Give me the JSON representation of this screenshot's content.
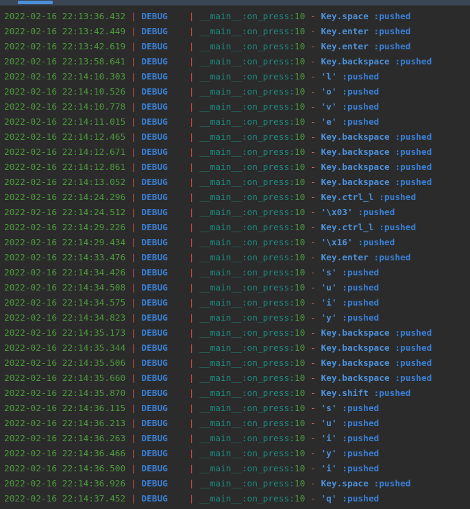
{
  "window": {
    "kind": "terminal-log-output",
    "background_color": "#2b2b2b",
    "topbar_color": "#3c4554",
    "scrollbar_color": "#4a90d9"
  },
  "colors": {
    "timestamp": "#4e9a3d",
    "separator": "#cc4c43",
    "level": "#3a7fd5",
    "module": "#1f8a82",
    "lineno": "#4e9a3d",
    "dash": "#d8705f",
    "message": "#3a7fd5"
  },
  "log": {
    "separator": "|",
    "dash": "-",
    "suffix": ":pushed",
    "lines": [
      {
        "timestamp": "2022-02-16 22:13:36.432",
        "level": "DEBUG",
        "module": "__main__",
        "func": "on_press",
        "lineno": "10",
        "key": "Key.space",
        "status": ":pushed"
      },
      {
        "timestamp": "2022-02-16 22:13:42.449",
        "level": "DEBUG",
        "module": "__main__",
        "func": "on_press",
        "lineno": "10",
        "key": "Key.enter",
        "status": ":pushed"
      },
      {
        "timestamp": "2022-02-16 22:13:42.619",
        "level": "DEBUG",
        "module": "__main__",
        "func": "on_press",
        "lineno": "10",
        "key": "Key.enter",
        "status": ":pushed"
      },
      {
        "timestamp": "2022-02-16 22:13:58.641",
        "level": "DEBUG",
        "module": "__main__",
        "func": "on_press",
        "lineno": "10",
        "key": "Key.backspace",
        "status": ":pushed"
      },
      {
        "timestamp": "2022-02-16 22:14:10.303",
        "level": "DEBUG",
        "module": "__main__",
        "func": "on_press",
        "lineno": "10",
        "key": "'l'",
        "status": ":pushed"
      },
      {
        "timestamp": "2022-02-16 22:14:10.526",
        "level": "DEBUG",
        "module": "__main__",
        "func": "on_press",
        "lineno": "10",
        "key": "'o'",
        "status": ":pushed"
      },
      {
        "timestamp": "2022-02-16 22:14:10.778",
        "level": "DEBUG",
        "module": "__main__",
        "func": "on_press",
        "lineno": "10",
        "key": "'v'",
        "status": ":pushed"
      },
      {
        "timestamp": "2022-02-16 22:14:11.015",
        "level": "DEBUG",
        "module": "__main__",
        "func": "on_press",
        "lineno": "10",
        "key": "'e'",
        "status": ":pushed"
      },
      {
        "timestamp": "2022-02-16 22:14:12.465",
        "level": "DEBUG",
        "module": "__main__",
        "func": "on_press",
        "lineno": "10",
        "key": "Key.backspace",
        "status": ":pushed"
      },
      {
        "timestamp": "2022-02-16 22:14:12.671",
        "level": "DEBUG",
        "module": "__main__",
        "func": "on_press",
        "lineno": "10",
        "key": "Key.backspace",
        "status": ":pushed"
      },
      {
        "timestamp": "2022-02-16 22:14:12.861",
        "level": "DEBUG",
        "module": "__main__",
        "func": "on_press",
        "lineno": "10",
        "key": "Key.backspace",
        "status": ":pushed"
      },
      {
        "timestamp": "2022-02-16 22:14:13.052",
        "level": "DEBUG",
        "module": "__main__",
        "func": "on_press",
        "lineno": "10",
        "key": "Key.backspace",
        "status": ":pushed"
      },
      {
        "timestamp": "2022-02-16 22:14:24.296",
        "level": "DEBUG",
        "module": "__main__",
        "func": "on_press",
        "lineno": "10",
        "key": "Key.ctrl_l",
        "status": ":pushed"
      },
      {
        "timestamp": "2022-02-16 22:14:24.512",
        "level": "DEBUG",
        "module": "__main__",
        "func": "on_press",
        "lineno": "10",
        "key": "'\\x03'",
        "status": ":pushed"
      },
      {
        "timestamp": "2022-02-16 22:14:29.226",
        "level": "DEBUG",
        "module": "__main__",
        "func": "on_press",
        "lineno": "10",
        "key": "Key.ctrl_l",
        "status": ":pushed"
      },
      {
        "timestamp": "2022-02-16 22:14:29.434",
        "level": "DEBUG",
        "module": "__main__",
        "func": "on_press",
        "lineno": "10",
        "key": "'\\x16'",
        "status": ":pushed"
      },
      {
        "timestamp": "2022-02-16 22:14:33.476",
        "level": "DEBUG",
        "module": "__main__",
        "func": "on_press",
        "lineno": "10",
        "key": "Key.enter",
        "status": ":pushed"
      },
      {
        "timestamp": "2022-02-16 22:14:34.426",
        "level": "DEBUG",
        "module": "__main__",
        "func": "on_press",
        "lineno": "10",
        "key": "'s'",
        "status": ":pushed"
      },
      {
        "timestamp": "2022-02-16 22:14:34.508",
        "level": "DEBUG",
        "module": "__main__",
        "func": "on_press",
        "lineno": "10",
        "key": "'u'",
        "status": ":pushed"
      },
      {
        "timestamp": "2022-02-16 22:14:34.575",
        "level": "DEBUG",
        "module": "__main__",
        "func": "on_press",
        "lineno": "10",
        "key": "'i'",
        "status": ":pushed"
      },
      {
        "timestamp": "2022-02-16 22:14:34.823",
        "level": "DEBUG",
        "module": "__main__",
        "func": "on_press",
        "lineno": "10",
        "key": "'y'",
        "status": ":pushed"
      },
      {
        "timestamp": "2022-02-16 22:14:35.173",
        "level": "DEBUG",
        "module": "__main__",
        "func": "on_press",
        "lineno": "10",
        "key": "Key.backspace",
        "status": ":pushed"
      },
      {
        "timestamp": "2022-02-16 22:14:35.344",
        "level": "DEBUG",
        "module": "__main__",
        "func": "on_press",
        "lineno": "10",
        "key": "Key.backspace",
        "status": ":pushed"
      },
      {
        "timestamp": "2022-02-16 22:14:35.506",
        "level": "DEBUG",
        "module": "__main__",
        "func": "on_press",
        "lineno": "10",
        "key": "Key.backspace",
        "status": ":pushed"
      },
      {
        "timestamp": "2022-02-16 22:14:35.660",
        "level": "DEBUG",
        "module": "__main__",
        "func": "on_press",
        "lineno": "10",
        "key": "Key.backspace",
        "status": ":pushed"
      },
      {
        "timestamp": "2022-02-16 22:14:35.870",
        "level": "DEBUG",
        "module": "__main__",
        "func": "on_press",
        "lineno": "10",
        "key": "Key.shift",
        "status": ":pushed"
      },
      {
        "timestamp": "2022-02-16 22:14:36.115",
        "level": "DEBUG",
        "module": "__main__",
        "func": "on_press",
        "lineno": "10",
        "key": "'s'",
        "status": ":pushed"
      },
      {
        "timestamp": "2022-02-16 22:14:36.213",
        "level": "DEBUG",
        "module": "__main__",
        "func": "on_press",
        "lineno": "10",
        "key": "'u'",
        "status": ":pushed"
      },
      {
        "timestamp": "2022-02-16 22:14:36.263",
        "level": "DEBUG",
        "module": "__main__",
        "func": "on_press",
        "lineno": "10",
        "key": "'i'",
        "status": ":pushed"
      },
      {
        "timestamp": "2022-02-16 22:14:36.466",
        "level": "DEBUG",
        "module": "__main__",
        "func": "on_press",
        "lineno": "10",
        "key": "'y'",
        "status": ":pushed"
      },
      {
        "timestamp": "2022-02-16 22:14:36.500",
        "level": "DEBUG",
        "module": "__main__",
        "func": "on_press",
        "lineno": "10",
        "key": "'i'",
        "status": ":pushed"
      },
      {
        "timestamp": "2022-02-16 22:14:36.926",
        "level": "DEBUG",
        "module": "__main__",
        "func": "on_press",
        "lineno": "10",
        "key": "Key.space",
        "status": ":pushed"
      },
      {
        "timestamp": "2022-02-16 22:14:37.452",
        "level": "DEBUG",
        "module": "__main__",
        "func": "on_press",
        "lineno": "10",
        "key": "'q'",
        "status": ":pushed"
      }
    ]
  }
}
